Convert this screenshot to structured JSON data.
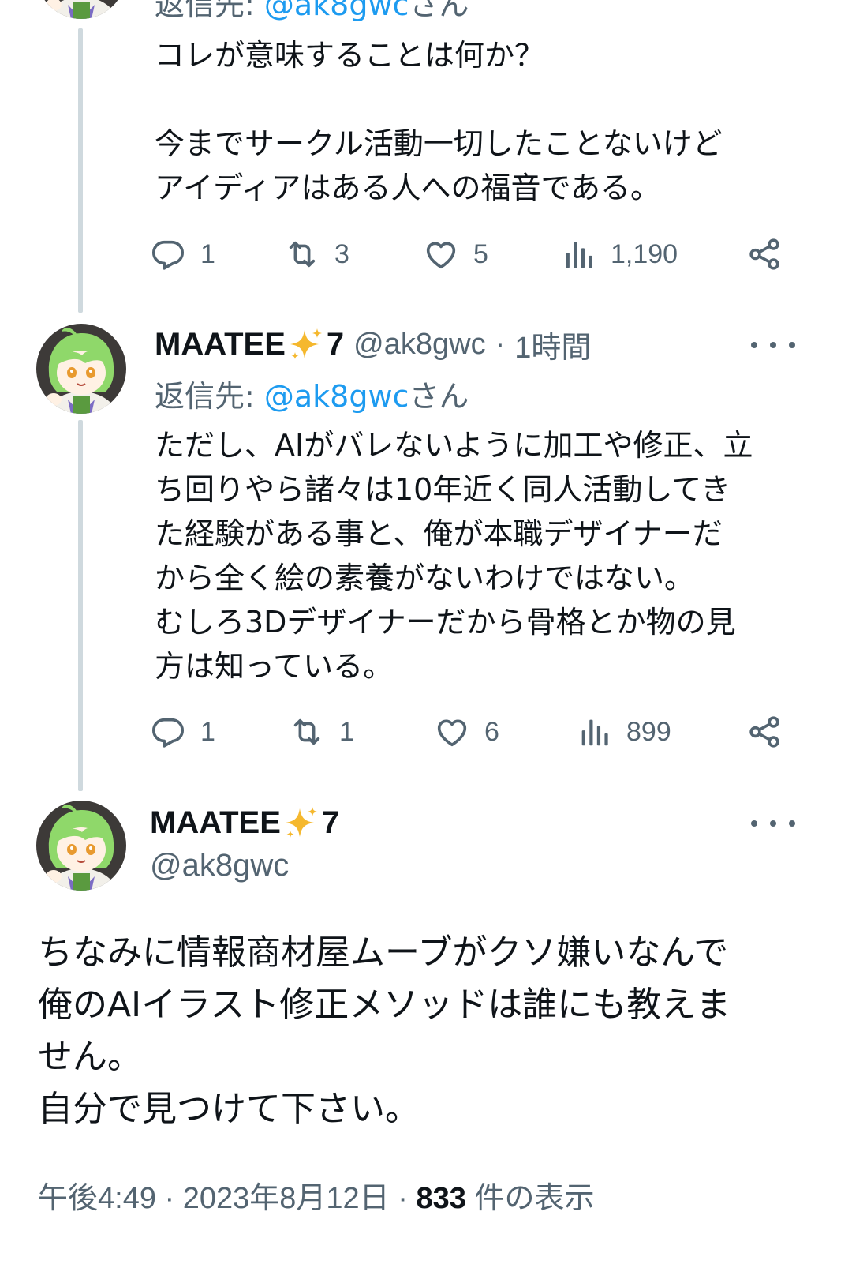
{
  "thread": {
    "tweet1": {
      "reply_to_prefix": "返信先: ",
      "reply_to_handle": "@ak8gwc",
      "reply_to_suffix": "さん",
      "text_lines": [
        "コレが意味することは何か？",
        "",
        "今までサークル活動一切したことないけど",
        "アイディアはある人への福音である。"
      ],
      "actions": {
        "replies": "1",
        "reposts": "3",
        "likes": "5",
        "views": "1,190"
      }
    },
    "tweet2": {
      "display_name": "MAATEE",
      "name_suffix": "7",
      "handle": "@ak8gwc",
      "time": "1時間",
      "reply_to_prefix": "返信先: ",
      "reply_to_handle": "@ak8gwc",
      "reply_to_suffix": "さん",
      "text_lines": [
        "ただし、AIがバレないように加工や修正、立",
        "ち回りやら諸々は10年近く同人活動してき",
        "た経験がある事と、俺が本職デザイナーだ",
        "から全く絵の素養がないわけではない。",
        "むしろ3Dデザイナーだから骨格とか物の見",
        "方は知っている。"
      ],
      "actions": {
        "replies": "1",
        "reposts": "1",
        "likes": "6",
        "views": "899"
      }
    },
    "main_tweet": {
      "display_name": "MAATEE",
      "name_suffix": "7",
      "handle": "@ak8gwc",
      "text_lines": [
        "ちなみに情報商材屋ムーブがクソ嫌いなんで",
        "俺のAIイラスト修正メソッドは誰にも教えま",
        "せん。",
        "自分で見つけて下さい。"
      ],
      "time": "午後4:49",
      "date": "2023年8月12日",
      "views_count": "833",
      "views_label": "件の表示"
    }
  },
  "icons": {
    "reply": "reply-icon",
    "repost": "repost-icon",
    "like": "heart-icon",
    "views": "views-icon",
    "share": "share-icon",
    "more": "more-icon",
    "sparkle": "sparkle-icon"
  },
  "colors": {
    "text": "#0f1419",
    "secondary": "#536471",
    "link": "#1d9bf0",
    "thread_line": "#cfd9de",
    "sparkle": "#f5b82e",
    "avatar_hair": "#9be27a"
  }
}
